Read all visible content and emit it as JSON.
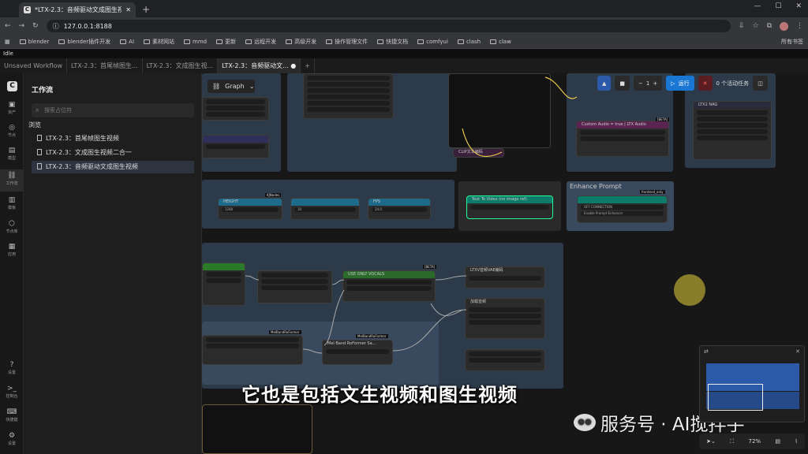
{
  "browser": {
    "tab_title": "*LTX-2.3：音频驱动文成图生视",
    "url": "127.0.0.1:8188",
    "new_tab": "+",
    "bookmarks": [
      "blender",
      "blender插件开发",
      "AI",
      "素材网站",
      "mmd",
      "更新",
      "远程开发",
      "高级开发",
      "操作管理文件",
      "快捷文档",
      "comfyui",
      "clash",
      "claw"
    ],
    "all_bookmarks": "所有书签"
  },
  "status": "Idle",
  "workflow_tabs": [
    "Unsaved Workflow",
    "LTX-2.3：首尾帧图生...",
    "LTX-2.3：文成图生视...",
    "LTX-2.3：音频驱动文..."
  ],
  "rail": {
    "items": [
      "资产",
      "节点",
      "模型",
      "工作流",
      "模板",
      "节点库",
      "应用",
      "设置"
    ],
    "bottom": [
      "设置",
      "控制台",
      "快捷键",
      "设置"
    ]
  },
  "sidebar": {
    "title": "工作流",
    "search_placeholder": "搜索占位符",
    "browse": "浏览",
    "items": [
      "LTX-2.3：首尾帧图生视频",
      "LTX-2.3：文成图生视频二合一",
      "LTX-2.3：音频驱动文成图生视频"
    ]
  },
  "canvas": {
    "graph_label": "Graph",
    "toolbar": {
      "run": "运行",
      "active": "0 个活动任务",
      "count": "1"
    },
    "nodes": {
      "text_to_video": "Text To Video (no image ref)",
      "enhance_prompt": "Enhance Prompt",
      "use_only_vocals": "USE ONLY VOCALS",
      "mel_band": "Mel Band RoFormer Sa...",
      "height": "HEIGHT",
      "fps": "FPS",
      "ltx2_nag": "LTX2 NAG",
      "custom_audio": "Custom Audio = true | LTX Audio",
      "enhance_toggle": "Enable Prompt Enhancer",
      "kjnodes": "KJNodes",
      "frontend_only": "frontend_only",
      "beta": "[BETA]",
      "melband_tag": "MelBandRoFormer",
      "clip_text": "CLIP文本编码",
      "ltxv_audio": "LTXV音频VAE编码",
      "vocal_sep": "加载音频",
      "height_val": "1280",
      "width_val": "10",
      "fps_val": "24.0",
      "off_connection": "OFF CONNECTION"
    },
    "zoom": "72%"
  },
  "subtitle": "它也是包括文生视频和图生视频",
  "watermark": "服务号 · AI搅拌手"
}
